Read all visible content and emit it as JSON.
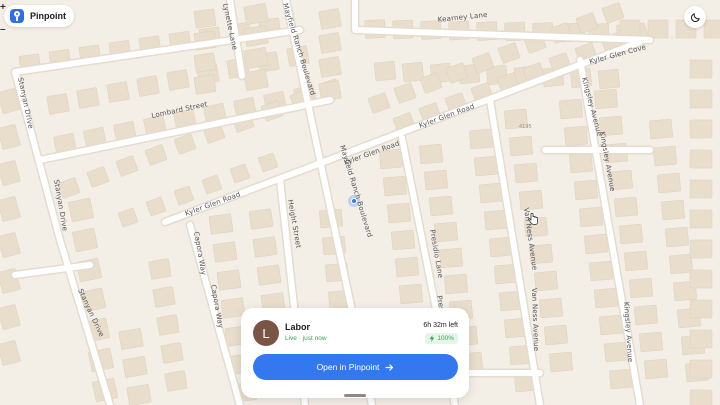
{
  "app": {
    "name": "Pinpoint"
  },
  "controls": {
    "theme_toggle_icon": "moon-icon",
    "zoom_in_icon": "plus-icon",
    "zoom_out_icon": "minus-icon",
    "zoom_in_glyph": "+",
    "zoom_out_glyph": "–"
  },
  "map": {
    "streets": [
      "Kearney Lane",
      "Lynette Lane",
      "Mayfield Ranch Boulevard",
      "Kyler Glen Cove",
      "Lombard Street",
      "Kingsley Avenue",
      "Kyler Glen Road",
      "Kyler Glen Road",
      "Kyler Glen Road",
      "Mayfield Ranch Boulevard",
      "Stanyan Drive",
      "Stanyan Drive",
      "Stanyan Drive",
      "Height Street",
      "Capora Way",
      "Capora Way",
      "Presidio Lane",
      "Presidio Lane",
      "Van Ness Avenue",
      "Van Ness Avenue",
      "Kingsley Avenue",
      "Kingsley Avenue"
    ],
    "address_number": "4195",
    "colors": {
      "background": "#f3eee6",
      "building": "#e9ddcb",
      "road": "#ffffff",
      "location": "#3b7ddd"
    }
  },
  "card": {
    "avatar_initial": "L",
    "name": "Labor",
    "status": "Live · just now",
    "time_left": "6h 32m left",
    "battery": "100%",
    "battery_icon": "bolt-icon",
    "button_label": "Open in Pinpoint",
    "button_icon": "arrow-right-icon",
    "accent": "#3478ef",
    "status_color": "#3aa35a"
  }
}
